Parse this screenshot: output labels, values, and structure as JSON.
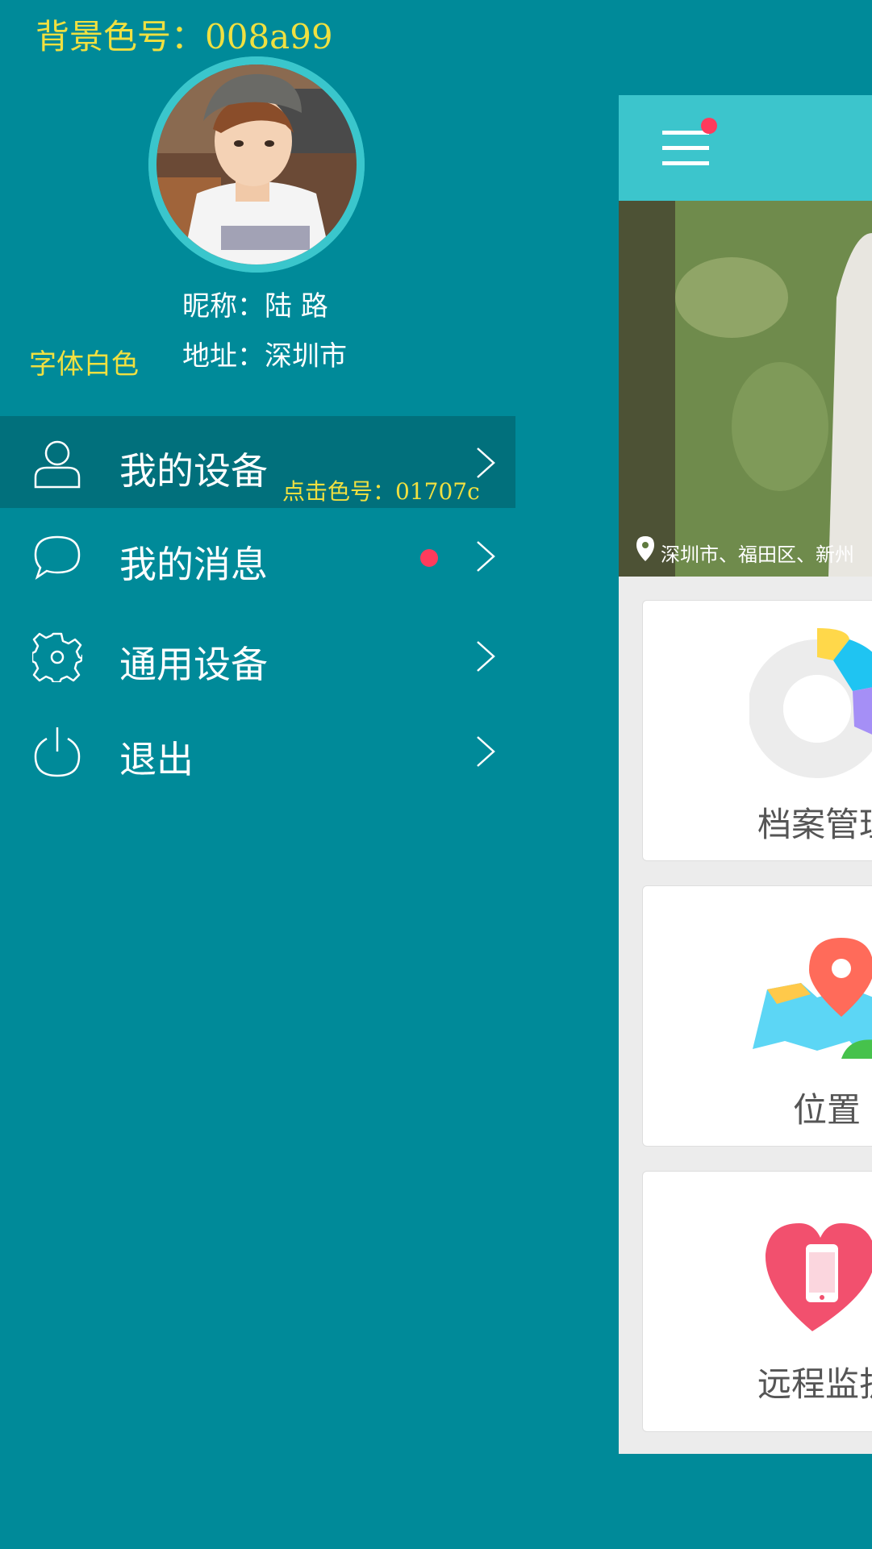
{
  "annotations": {
    "background_color": "背景色号：008a99",
    "font_color": "字体白色",
    "click_color": "点击色号：01707c"
  },
  "profile": {
    "nickname": "昵称：陆  路",
    "address": "地址：深圳市"
  },
  "menu": {
    "items": [
      {
        "label": "我的设备",
        "icon": "user-icon",
        "active": true
      },
      {
        "label": "我的消息",
        "icon": "chat-icon",
        "badge": true
      },
      {
        "label": "通用设备",
        "icon": "gear-icon"
      },
      {
        "label": "退出",
        "icon": "power-icon"
      }
    ]
  },
  "preview": {
    "location": "深圳市、福田区、新州",
    "cards": [
      {
        "label": "档案管理",
        "icon": "donut-chart-icon"
      },
      {
        "label": "位置",
        "icon": "map-pin-icon"
      },
      {
        "label": "远程监护",
        "icon": "heart-phone-icon"
      }
    ]
  },
  "colors": {
    "background": "#008a99",
    "active_item": "#01707c",
    "header": "#3cc5cc",
    "badge": "#ff3b5c",
    "annotation": "#f0e040"
  }
}
